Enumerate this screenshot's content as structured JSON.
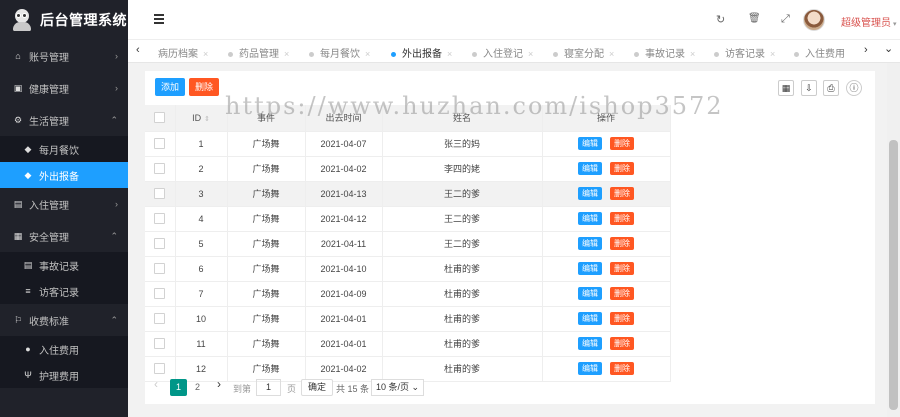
{
  "app": {
    "title": "后台管理系统"
  },
  "sidebar": {
    "menu": [
      {
        "label": "账号管理",
        "icon": "home-icon",
        "glyph": "⌂",
        "expanded": false
      },
      {
        "label": "健康管理",
        "icon": "window-icon",
        "glyph": "▣",
        "expanded": false
      },
      {
        "label": "生活管理",
        "icon": "gears-icon",
        "glyph": "⚙",
        "expanded": true,
        "children": [
          {
            "label": "每月餐饮",
            "icon": "car-icon",
            "glyph": "◆",
            "active": false
          },
          {
            "label": "外出报备",
            "icon": "car-icon",
            "glyph": "◆",
            "active": true
          }
        ]
      },
      {
        "label": "入住管理",
        "icon": "file-icon",
        "glyph": "▤",
        "expanded": false
      },
      {
        "label": "安全管理",
        "icon": "calendar-icon",
        "glyph": "▦",
        "expanded": true,
        "children": [
          {
            "label": "事故记录",
            "icon": "list-alt-icon",
            "glyph": "▤",
            "active": false
          },
          {
            "label": "访客记录",
            "icon": "list-icon",
            "glyph": "≡",
            "active": false
          }
        ]
      },
      {
        "label": "收费标准",
        "icon": "flag-icon",
        "glyph": "⚐",
        "expanded": true,
        "children": [
          {
            "label": "入住费用",
            "icon": "circle-icon",
            "glyph": "●",
            "active": false
          },
          {
            "label": "护理费用",
            "icon": "fork-icon",
            "glyph": "Ψ",
            "active": false
          }
        ]
      }
    ]
  },
  "header": {
    "menu_toggle_icon": "hamburger-icon",
    "refresh_glyph": "↻",
    "trash_glyph": "🗑",
    "fullscreen_glyph": "⤢",
    "username": "超级管理员",
    "caret": "▾"
  },
  "tabs": {
    "left_arrow": "‹",
    "right_arrow": "›",
    "more_arrow": "⌄",
    "close_glyph": "×",
    "items": [
      {
        "label": "病历档案",
        "active": false
      },
      {
        "label": "药品管理",
        "active": false
      },
      {
        "label": "每月餐饮",
        "active": false
      },
      {
        "label": "外出报备",
        "active": true
      },
      {
        "label": "入住登记",
        "active": false
      },
      {
        "label": "寝室分配",
        "active": false
      },
      {
        "label": "事故记录",
        "active": false
      },
      {
        "label": "访客记录",
        "active": false
      },
      {
        "label": "入住费用",
        "active": false
      }
    ]
  },
  "toolbar": {
    "add_label": "添加",
    "delete_label": "删除",
    "columns_glyph": "▦",
    "export_glyph": "⇩",
    "print_glyph": "⎙",
    "info_glyph": "ⓘ"
  },
  "table": {
    "headers": {
      "id": "ID",
      "event": "事件",
      "time": "出去时间",
      "name": "姓名",
      "actions": "操作",
      "sort_glyph": "⇕"
    },
    "edit_label": "编辑",
    "delete_label": "删除",
    "rows": [
      {
        "id": "1",
        "event": "广场舞",
        "time": "2021-04-07",
        "name": "张三的妈"
      },
      {
        "id": "2",
        "event": "广场舞",
        "time": "2021-04-02",
        "name": "李四的姥"
      },
      {
        "id": "3",
        "event": "广场舞",
        "time": "2021-04-13",
        "name": "王二的爹"
      },
      {
        "id": "4",
        "event": "广场舞",
        "time": "2021-04-12",
        "name": "王二的爹"
      },
      {
        "id": "5",
        "event": "广场舞",
        "time": "2021-04-11",
        "name": "王二的爹"
      },
      {
        "id": "6",
        "event": "广场舞",
        "time": "2021-04-10",
        "name": "杜甫的爹"
      },
      {
        "id": "7",
        "event": "广场舞",
        "time": "2021-04-09",
        "name": "杜甫的爹"
      },
      {
        "id": "10",
        "event": "广场舞",
        "time": "2021-04-01",
        "name": "杜甫的爹"
      },
      {
        "id": "11",
        "event": "广场舞",
        "time": "2021-04-01",
        "name": "杜甫的爹"
      },
      {
        "id": "12",
        "event": "广场舞",
        "time": "2021-04-02",
        "name": "杜甫的爹"
      }
    ]
  },
  "pager": {
    "prev_glyph": "‹",
    "next_glyph": "›",
    "current_page": "1",
    "next_page": "2",
    "goto_label": "到第",
    "page_input": "1",
    "page_unit": "页",
    "confirm_label": "确定",
    "total_label": "共 15 条",
    "page_size": "10 条/页 ⌄"
  },
  "watermark": "https://www.huzhan.com/ishop3572",
  "colors": {
    "accent": "#1e9fff",
    "danger": "#ff5722",
    "pager_active": "#009688",
    "sidebar_bg": "#20222a"
  }
}
